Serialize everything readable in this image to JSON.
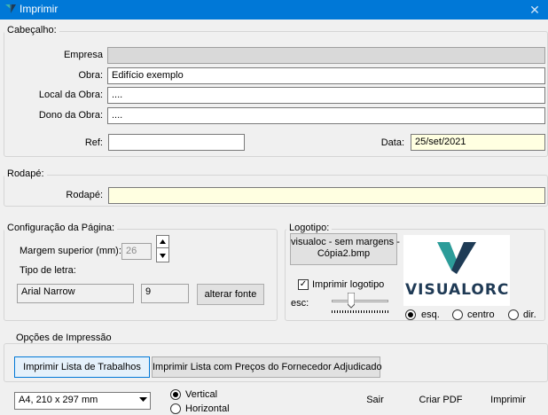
{
  "window": {
    "title": "Imprimir",
    "close_glyph": "✕"
  },
  "header": {
    "legend": "Cabeçalho:",
    "empresa_label": "Empresa",
    "empresa_value": "",
    "obra_label": "Obra:",
    "obra_value": "Edifício exemplo",
    "local_label": "Local da Obra:",
    "local_value": "....",
    "dono_label": "Dono da Obra:",
    "dono_value": "....",
    "ref_label": "Ref:",
    "ref_value": "",
    "data_label": "Data:",
    "data_value": "25/set/2021"
  },
  "footer": {
    "legend": "Rodapé:",
    "rodape_label": "Rodapé:",
    "rodape_value": ""
  },
  "page_config": {
    "legend": "Configuração da Página:",
    "margin_label": "Margem superior (mm):",
    "margin_value": "26",
    "font_type_label": "Tipo de letra:",
    "font_name": "Arial Narrow",
    "font_size": "9",
    "change_font_button": "alterar fonte"
  },
  "logo": {
    "legend": "Logotipo:",
    "file_button_line1": "visualoc - sem margens -",
    "file_button_line2": "Cópia2.bmp",
    "print_logo_label": "Imprimir logotipo",
    "print_logo_checked": true,
    "esc_label": "esc:",
    "logo_text": "VISUALORC",
    "align_options": [
      "esq.",
      "centro",
      "dir."
    ],
    "align_selected": "esq.",
    "brand_colors": {
      "teal": "#1f8b8c",
      "navy": "#1f3a55"
    }
  },
  "print_options": {
    "legend": "Opções de Impressão",
    "tab_work_list": "Imprimir Lista de Trabalhos",
    "tab_supplier_prices": "Imprimir Lista com Preços do Fornecedor Adjudicado"
  },
  "bottom": {
    "paper_size": "A4, 210 x 297 mm",
    "orientation_vertical": "Vertical",
    "orientation_horizontal": "Horizontal",
    "orientation_selected": "Vertical",
    "exit_button": "Sair",
    "pdf_button": "Criar PDF",
    "print_button": "Imprimir"
  }
}
